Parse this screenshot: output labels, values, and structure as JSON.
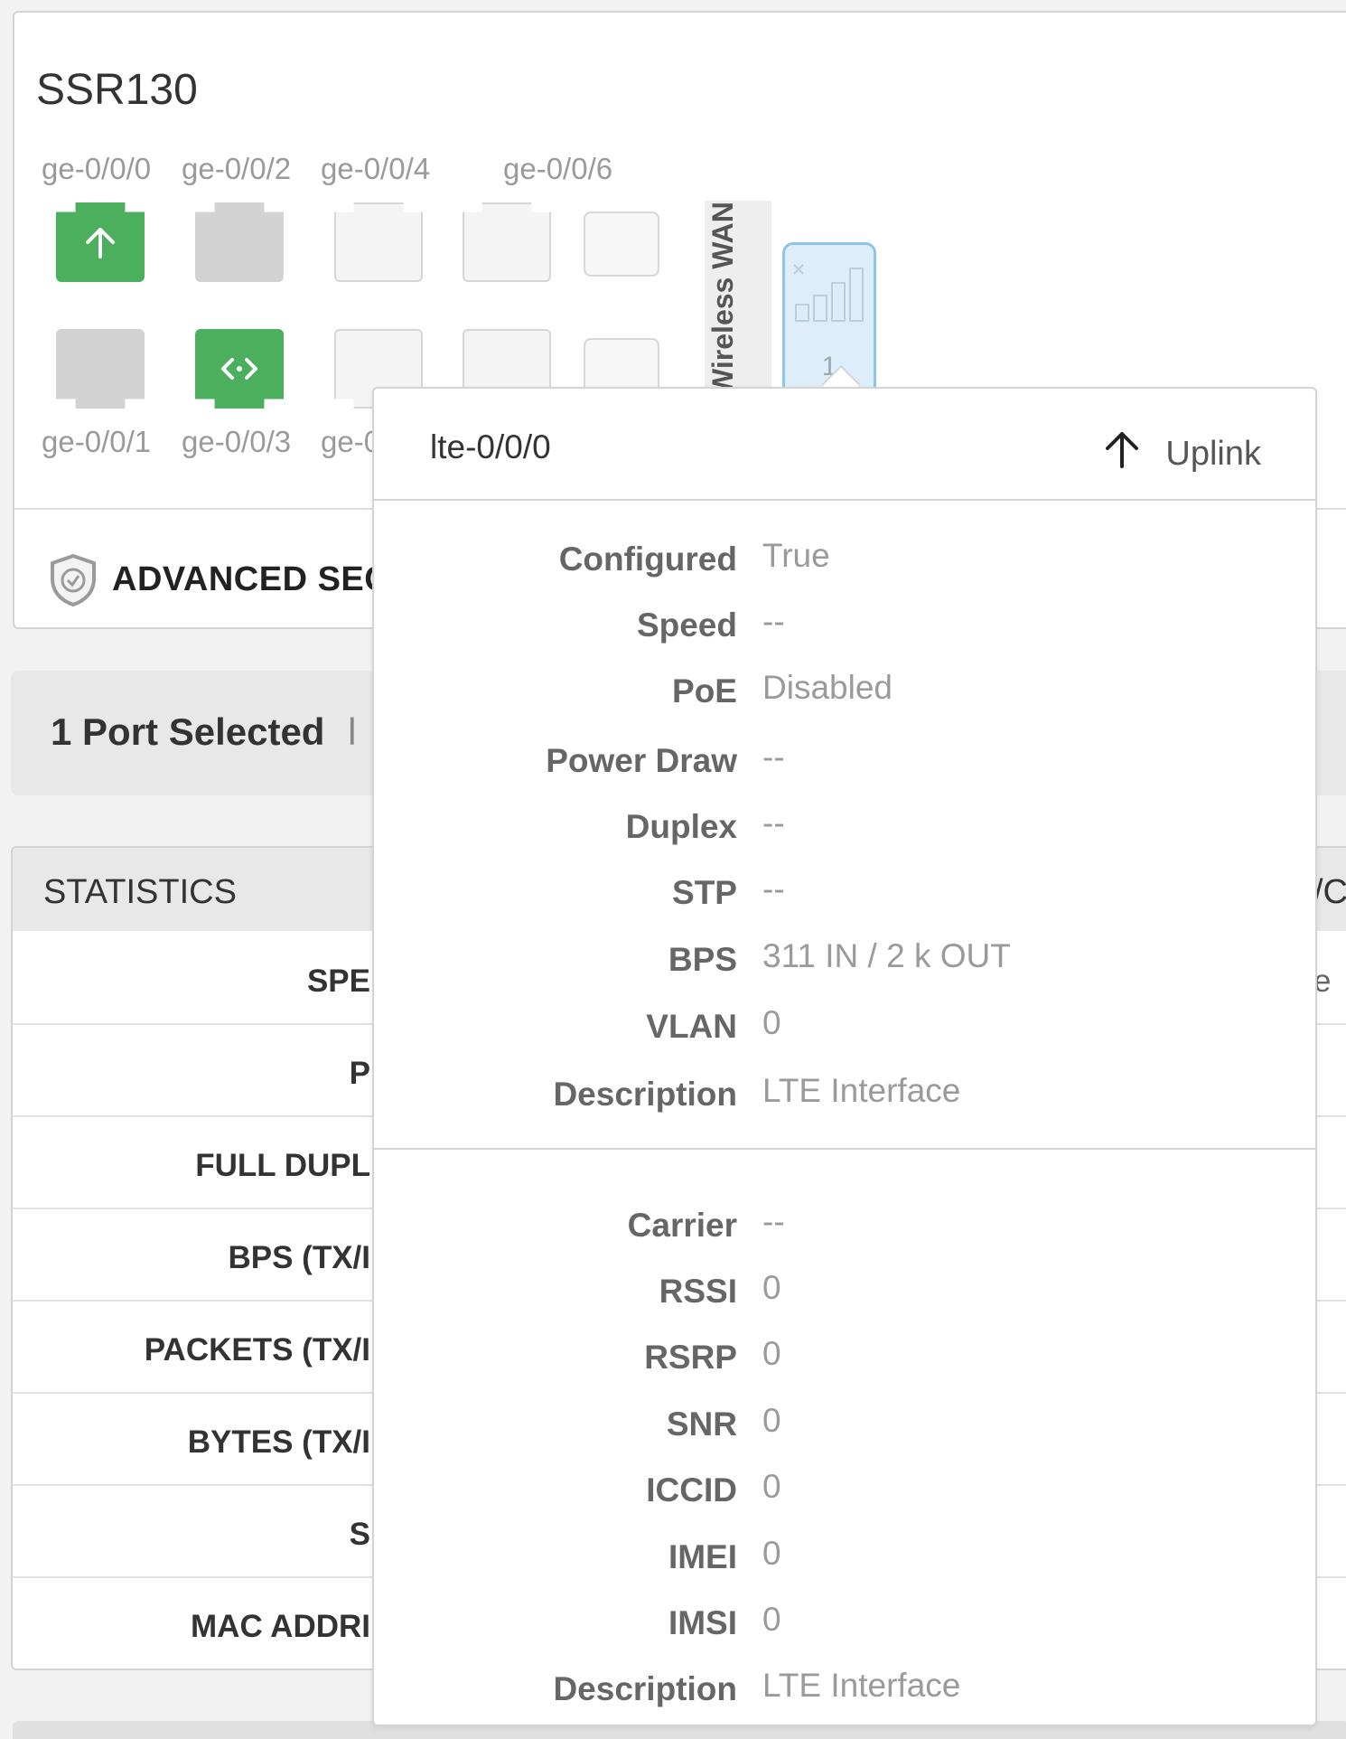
{
  "device": {
    "title": "SSR130",
    "ports_top": [
      {
        "label": "ge-0/0/0",
        "state": "uplink"
      },
      {
        "label": "ge-0/0/2",
        "state": "disconnected"
      },
      {
        "label": "ge-0/0/4",
        "state": "empty"
      },
      {
        "label": "ge-0/0/6",
        "state": "empty"
      }
    ],
    "ports_bottom": [
      {
        "label": "ge-0/0/1",
        "state": "disconnected"
      },
      {
        "label": "ge-0/0/3",
        "state": "trunk"
      },
      {
        "label": "ge-0",
        "state": "empty"
      }
    ],
    "wireless_wan_label": "Wireless WAN",
    "lte_port_number": "1",
    "advanced_security_label": "ADVANCED SECU"
  },
  "selection": {
    "text": "1 Port Selected",
    "trailing": "l"
  },
  "statistics": {
    "title": "STATISTICS",
    "right_header": "/C",
    "right_value": "e",
    "rows": [
      "SPE",
      "P",
      "FULL DUPL",
      "BPS (TX/I",
      "PACKETS (TX/I",
      "BYTES (TX/I",
      "S",
      "MAC ADDRI"
    ]
  },
  "popover": {
    "title": "lte-0/0/0",
    "status": "Uplink",
    "interface_fields": [
      {
        "label": "Configured",
        "value": "True"
      },
      {
        "label": "Speed",
        "value": "--"
      },
      {
        "label": "PoE",
        "value": "Disabled"
      },
      {
        "label": "Power Draw",
        "value": "--"
      },
      {
        "label": "Duplex",
        "value": "--"
      },
      {
        "label": "STP",
        "value": "--"
      },
      {
        "label": "BPS",
        "value": "311 IN / 2 k OUT"
      },
      {
        "label": "VLAN",
        "value": "0"
      },
      {
        "label": "Description",
        "value": "LTE Interface"
      }
    ],
    "lte_fields": [
      {
        "label": "Carrier",
        "value": "--"
      },
      {
        "label": "RSSI",
        "value": "0"
      },
      {
        "label": "RSRP",
        "value": "0"
      },
      {
        "label": "SNR",
        "value": "0"
      },
      {
        "label": "ICCID",
        "value": "0"
      },
      {
        "label": "IMEI",
        "value": "0"
      },
      {
        "label": "IMSI",
        "value": "0"
      },
      {
        "label": "Description",
        "value": "LTE Interface"
      }
    ]
  },
  "colors": {
    "port_green": "#4caf5e",
    "port_gray": "#d3d3d3",
    "lte_border": "#8cc5ea",
    "lte_fill": "#ddeefa"
  }
}
